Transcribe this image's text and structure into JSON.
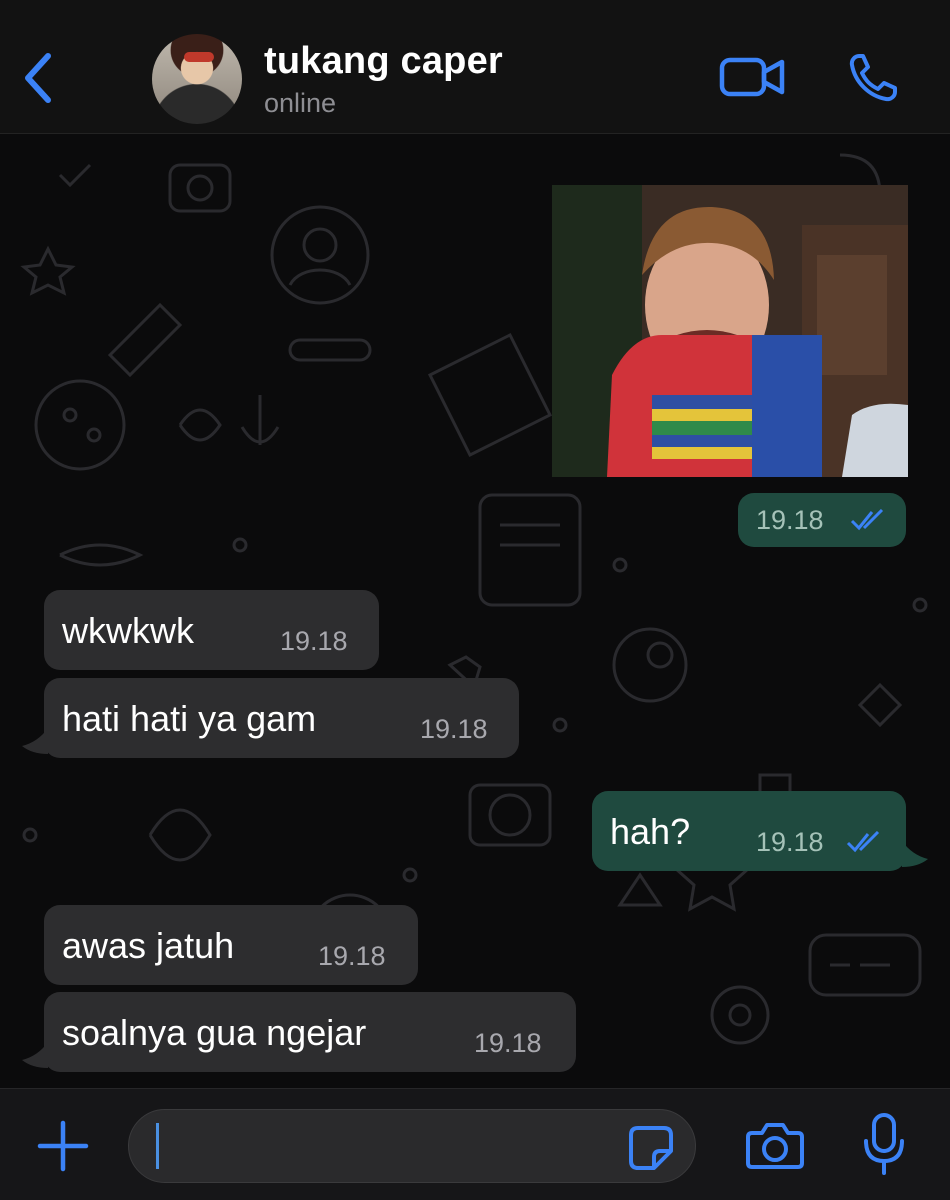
{
  "header": {
    "contact_name": "tukang caper",
    "status": "online"
  },
  "messages": [
    {
      "direction": "outgoing",
      "type": "image",
      "time": "19.18",
      "read": true
    },
    {
      "direction": "incoming",
      "text": "wkwkwk",
      "time": "19.18"
    },
    {
      "direction": "incoming",
      "text": "hati hati ya gam",
      "time": "19.18"
    },
    {
      "direction": "outgoing",
      "text": "hah?",
      "time": "19.18",
      "read": true
    },
    {
      "direction": "incoming",
      "text": "awas jatuh",
      "time": "19.18"
    },
    {
      "direction": "incoming",
      "text": "soalnya gua ngejar",
      "time": "19.18"
    }
  ],
  "composer": {
    "value": "",
    "placeholder": ""
  },
  "icons": {
    "back": "chevron-left-icon",
    "video": "video-camera-icon",
    "call": "phone-icon",
    "plus": "plus-icon",
    "sticker": "sticker-icon",
    "camera": "camera-icon",
    "mic": "microphone-icon"
  },
  "colors": {
    "accent": "#3b82f6",
    "incoming_bubble": "#2d2d2f",
    "outgoing_bubble": "#1f4a3f",
    "background": "#0b0b0c"
  }
}
